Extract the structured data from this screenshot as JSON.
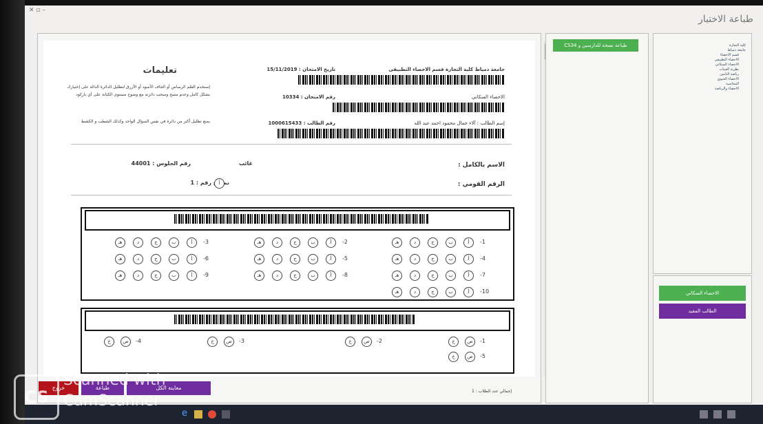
{
  "app": {
    "title": "طباعة الاختبار"
  },
  "paper": {
    "university_line": "جامعة دمياط كلية التجارة قسم الاحصاء التطبيقى",
    "exam_date_label": "تاريخ الامتحان : 15/11/2019",
    "subject": "الاحصاء السكاني",
    "exam_no_label": "رقم الامتحان : 10334",
    "student_line": "إسم الطالب : آلاء جمال محمود احمد عبد الله",
    "student_no_label": "رقم الطالب : 1000615433",
    "instructions_title": "تعليمات",
    "instructions": [
      "إستخدم القلم الرصاص أو الجاف الأسود أو الأزرق لتظليل الدائرة الدالة على إختيارك بشكل كامل وعدم مسح وسحب دائرته مع وضوح مستوى الكتابة على أي باركود",
      "يمنع تظليل أكثر من دائرة في نفس السؤال الواحد وكذلك الشطب و الكشط"
    ],
    "full_name_label": "الاسم بالكامل :",
    "national_id_label": "الرقم القومي :",
    "seat_no_label": "رقم الجلوس : 44001",
    "absent_label": "غائب",
    "model_no_label": "نموذج رقم : 1",
    "model_circle": "أ",
    "mcq_options": [
      "أ",
      "ب",
      "ج",
      "د",
      "هـ"
    ],
    "tf_options": [
      "ص",
      "خ"
    ],
    "mcq_questions": [
      "-1",
      "-2",
      "-3",
      "-4",
      "-5",
      "-6",
      "-7",
      "-8",
      "-9",
      "-10"
    ],
    "tf_questions": [
      "-1",
      "-2",
      "-3",
      "-4",
      "-5"
    ],
    "total_students": "إجمالي عدد الطلاب : 1"
  },
  "middle": {
    "print_button": "طباعة نسخة للدارسين و CS34"
  },
  "tree": {
    "items": [
      "كلية التجارة",
      "جامعة دمياط",
      "قسم الاحصاء",
      "الاحصاء التطبيقي",
      "الاحصاء السكاني",
      "نظرية العينات",
      "رياضة التامين",
      "الاحصاء الحيوي",
      "المحاسبة",
      "الاحصاء والرياضة"
    ]
  },
  "right_buttons": {
    "subject": "الاحصاء السكاني",
    "by_network": "الطالب المقيد"
  },
  "bottom_buttons": [
    "خروج",
    "طباعة",
    "معاينة الكل"
  ],
  "watermark": {
    "logo": "CS",
    "line1": "Scanned with",
    "line2": "CamScanner"
  },
  "colors": {
    "green": "#4caf50",
    "purple": "#6f2c9e",
    "red": "#b3141c"
  }
}
